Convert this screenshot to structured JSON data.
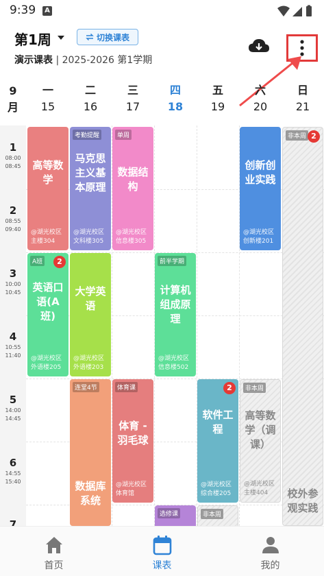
{
  "status": {
    "time": "9:39",
    "notif_letter": "A"
  },
  "header": {
    "week": "第1周",
    "switch_label": "切换课表",
    "schedule_name": "演示课表",
    "term": " | 2025-2026 第1学期"
  },
  "days": {
    "month_num": "9",
    "month_unit": "月",
    "list": [
      {
        "dw": "一",
        "dn": "15"
      },
      {
        "dw": "二",
        "dn": "16"
      },
      {
        "dw": "三",
        "dn": "17"
      },
      {
        "dw": "四",
        "dn": "18"
      },
      {
        "dw": "五",
        "dn": "19"
      },
      {
        "dw": "六",
        "dn": "20"
      },
      {
        "dw": "日",
        "dn": "21"
      }
    ]
  },
  "periods": [
    {
      "n": "1",
      "s": "08:00",
      "e": "08:45"
    },
    {
      "n": "2",
      "s": "08:55",
      "e": "09:40"
    },
    {
      "n": "3",
      "s": "10:00",
      "e": "10:45"
    },
    {
      "n": "4",
      "s": "10:55",
      "e": "11:40"
    },
    {
      "n": "5",
      "s": "14:00",
      "e": "14:45"
    },
    {
      "n": "6",
      "s": "14:55",
      "e": "15:40"
    },
    {
      "n": "7",
      "s": "",
      "e": ""
    }
  ],
  "courses": {
    "c1": {
      "name": "高等数学",
      "loc": "@湖光校区 主楼304",
      "color": "#e98080"
    },
    "c2": {
      "tag": "考勤提醒",
      "name": "马克思主义基本原理",
      "loc": "@湖光校区 文科楼305",
      "color": "#8e8fd6"
    },
    "c3": {
      "tag": "单周",
      "name": "数据结构",
      "loc": "@湖光校区 信息楼305",
      "color": "#f28ac9"
    },
    "c4": {
      "name": "创新创业实践",
      "loc": "@湖光校区 创新楼201",
      "color": "#4f8fe0"
    },
    "c5": {
      "tag": "非本周",
      "badge": "2",
      "name": "校外参观实践"
    },
    "c6": {
      "tag": "A班",
      "badge": "2",
      "name": "英语口语(A班)",
      "loc": "@湖光校区 外语楼205",
      "color": "#5ddf98"
    },
    "c7": {
      "name": "大学英语",
      "loc": "@湖光校区 外语楼203",
      "color": "#a6e04a"
    },
    "c8": {
      "tag": "前半学期",
      "name": "计算机组成原理",
      "loc": "@湖光校区 信息楼502",
      "color": "#5ddf98"
    },
    "c9": {
      "tag": "连堂4节",
      "name": "数据库系统",
      "color": "#f2a07a"
    },
    "c10": {
      "tag": "体育课",
      "name": "体育 - 羽毛球",
      "loc": "@湖光校区 体育馆",
      "color": "#e57e7e"
    },
    "c11": {
      "badge": "2",
      "name": "软件工程",
      "loc": "@湖光校区 综合楼205",
      "color": "#6ab6c8"
    },
    "c12": {
      "tag": "非本周",
      "name": "高等数学（调课）",
      "loc": "@湖光校区 主楼404"
    },
    "c13": {
      "tag": "选修课",
      "color": "#b584d8"
    },
    "c14": {
      "tag": "非本周"
    }
  },
  "nav": {
    "home": "首页",
    "schedule": "课表",
    "mine": "我的"
  },
  "colors": {
    "accent": "#2f83d6",
    "highlight": "#e23a3a"
  }
}
